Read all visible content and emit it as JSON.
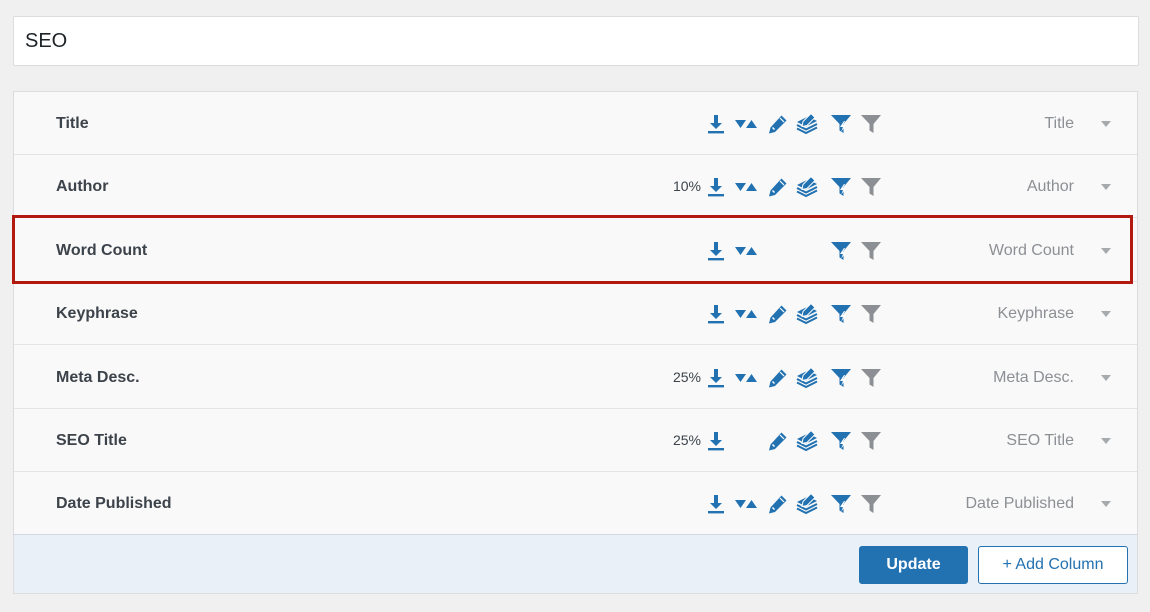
{
  "field": {
    "value": "SEO"
  },
  "colors": {
    "accent": "#2271b1",
    "filter_icon": "#8c8f94",
    "highlight_border": "#b21a10",
    "footer_bg": "#e9f0f8"
  },
  "rows": [
    {
      "label": "Title",
      "percent": "",
      "value": "Title",
      "icons": [
        "export-icon",
        "sort-icon",
        "edit-pencil-icon",
        "bulk-edit-icon",
        "smart-filter-icon",
        "filter-icon"
      ]
    },
    {
      "label": "Author",
      "percent": "10%",
      "value": "Author",
      "icons": [
        "export-icon",
        "sort-icon",
        "edit-pencil-icon",
        "bulk-edit-icon",
        "smart-filter-icon",
        "filter-icon"
      ]
    },
    {
      "label": "Word Count",
      "percent": "",
      "value": "Word Count",
      "highlighted": true,
      "icons": [
        "export-icon",
        "sort-icon",
        "smart-filter-icon",
        "filter-icon"
      ]
    },
    {
      "label": "Keyphrase",
      "percent": "",
      "value": "Keyphrase",
      "icons": [
        "export-icon",
        "sort-icon",
        "edit-pencil-icon",
        "bulk-edit-icon",
        "smart-filter-icon",
        "filter-icon"
      ]
    },
    {
      "label": "Meta Desc.",
      "percent": "25%",
      "value": "Meta Desc.",
      "icons": [
        "export-icon",
        "sort-icon",
        "edit-pencil-icon",
        "bulk-edit-icon",
        "smart-filter-icon",
        "filter-icon"
      ]
    },
    {
      "label": "SEO Title",
      "percent": "25%",
      "value": "SEO Title",
      "icons": [
        "export-icon",
        "edit-pencil-icon",
        "bulk-edit-icon",
        "smart-filter-icon",
        "filter-icon"
      ]
    },
    {
      "label": "Date Published",
      "percent": "",
      "value": "Date Published",
      "icons": [
        "export-icon",
        "sort-icon",
        "edit-pencil-icon",
        "bulk-edit-icon",
        "smart-filter-icon",
        "filter-icon"
      ]
    }
  ],
  "footer": {
    "update_label": "Update",
    "add_column_label": "+ Add Column"
  }
}
